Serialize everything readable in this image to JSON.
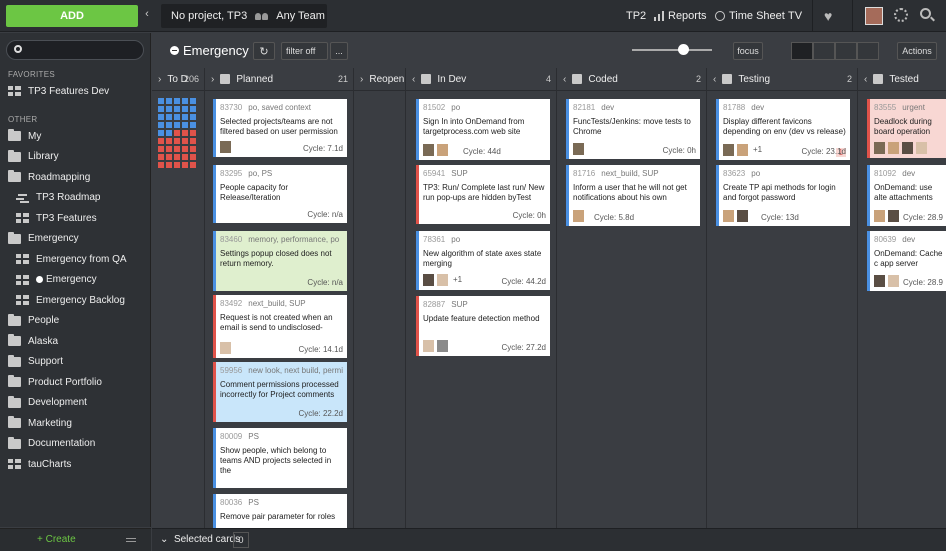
{
  "top": {
    "add": "ADD",
    "context_project": "No project, TP3",
    "context_team": "Any Team",
    "nav": [
      "TP2",
      "Reports",
      "Time Sheet",
      "TV"
    ]
  },
  "sidebar": {
    "favorites_header": "FAVORITES",
    "favorites": [
      {
        "label": "TP3 Features Dev",
        "icon": "board-icon"
      }
    ],
    "other_header": "OTHER",
    "items": [
      {
        "label": "My",
        "icon": "folder-icon",
        "indent": 0
      },
      {
        "label": "Library",
        "icon": "folder-icon",
        "indent": 0
      },
      {
        "label": "Roadmapping",
        "icon": "folder-icon",
        "indent": 0
      },
      {
        "label": "TP3 Roadmap",
        "icon": "roadmap-icon",
        "indent": 1
      },
      {
        "label": "TP3 Features",
        "icon": "board-icon",
        "indent": 1
      },
      {
        "label": "Emergency",
        "icon": "folder-icon",
        "indent": 0
      },
      {
        "label": "Emergency from QA",
        "icon": "board-icon",
        "indent": 1
      },
      {
        "label": "Emergency",
        "icon": "board-icon",
        "indent": 1,
        "active": true
      },
      {
        "label": "Emergency Backlog",
        "icon": "board-icon",
        "indent": 1
      },
      {
        "label": "People",
        "icon": "folder-icon",
        "indent": 0
      },
      {
        "label": "Alaska",
        "icon": "folder-icon",
        "indent": 0
      },
      {
        "label": "Support",
        "icon": "folder-icon",
        "indent": 0
      },
      {
        "label": "Product Portfolio",
        "icon": "folder-icon",
        "indent": 0
      },
      {
        "label": "Development",
        "icon": "folder-icon",
        "indent": 0
      },
      {
        "label": "Marketing",
        "icon": "folder-icon",
        "indent": 0
      },
      {
        "label": "Documentation",
        "icon": "folder-icon",
        "indent": 0
      },
      {
        "label": "tauCharts",
        "icon": "board-icon",
        "indent": 0
      }
    ],
    "create": "+ Create"
  },
  "board": {
    "title": "Emergency",
    "filter": "filter off",
    "more": "...",
    "focus": "focus",
    "actions": "Actions",
    "selected_cards": "Selected cards",
    "selected_count": "0"
  },
  "columns": [
    {
      "name": "To D",
      "count": "206"
    },
    {
      "name": "Planned",
      "count": "21"
    },
    {
      "name": "Reopen",
      "count": ""
    },
    {
      "name": "In Dev",
      "count": "4"
    },
    {
      "name": "Coded",
      "count": "2"
    },
    {
      "name": "Testing",
      "count": "2"
    },
    {
      "name": "Tested",
      "count": ""
    }
  ],
  "cards": {
    "planned": [
      {
        "id": "83730",
        "tags": "po, saved context",
        "title": "Selected projects/teams are not filtered based on user permission",
        "cycle": "Cycle: 7.1d"
      },
      {
        "id": "83295",
        "tags": "po, PS",
        "title": "People capacity for Release/Iteration",
        "cycle": "Cycle: n/a"
      },
      {
        "id": "83460",
        "tags": "memory, performance, po",
        "title": "Settings popup closed does not return memory.",
        "cycle": "Cycle: n/a"
      },
      {
        "id": "83492",
        "tags": "next_build, SUP",
        "title": "Request is not created when an email is send to undisclosed-",
        "cycle": "Cycle: 14.1d"
      },
      {
        "id": "59956",
        "tags": "new look, next build, permi",
        "title": "Comment permissions processed incorrectly for Project comments",
        "cycle": "Cycle: 22.2d"
      },
      {
        "id": "80009",
        "tags": "PS",
        "title": "Show people, which belong to teams AND projects selected in the",
        "cycle": ""
      },
      {
        "id": "80036",
        "tags": "PS",
        "title": "Remove pair parameter for roles",
        "cycle": ""
      }
    ],
    "indev": [
      {
        "id": "81502",
        "tags": "po",
        "title": "Sign In into OnDemand from targetprocess.com web site",
        "cycle": "Cycle: 44d"
      },
      {
        "id": "65941",
        "tags": "SUP",
        "title": "TP3: Run/ Complete last run/ New run pop-ups are hidden byTest",
        "cycle": "Cycle: 0h"
      },
      {
        "id": "78361",
        "tags": "po",
        "title": "New algorithm of state axes state merging",
        "cycle": "Cycle: 44.2d",
        "extra": "+1"
      },
      {
        "id": "82887",
        "tags": "SUP",
        "title": "Update feature detection method",
        "cycle": "Cycle: 27.2d"
      }
    ],
    "coded": [
      {
        "id": "82181",
        "tags": "dev",
        "title": "FuncTests/Jenkins: move tests to Chrome",
        "cycle": "Cycle: 0h"
      },
      {
        "id": "81716",
        "tags": "next_build, SUP",
        "title": "Inform a user that he will not get notifications about his own",
        "cycle": "Cycle: 5.8d"
      }
    ],
    "testing": [
      {
        "id": "81788",
        "tags": "dev",
        "title": "Display different favicons depending on env (dev vs release)",
        "cycle": "Cycle: 23.1d",
        "extra": "+1",
        "badge": "1"
      },
      {
        "id": "83623",
        "tags": "po",
        "title": "Create TP api methods for login and forgot password",
        "cycle": "Cycle: 13d"
      }
    ],
    "tested": [
      {
        "id": "83555",
        "tags": "urgent",
        "title": "Deadlock during board operation",
        "cycle": ""
      },
      {
        "id": "81092",
        "tags": "dev",
        "title": "OnDemand: use alte attachments",
        "cycle": "Cycle: 28.9"
      },
      {
        "id": "80639",
        "tags": "dev",
        "title": "OnDemand: Cache c app server",
        "cycle": "Cycle: 28.9"
      }
    ]
  },
  "colors": {
    "accent": "#6cc644",
    "bg": "#3a3d42",
    "sidebar": "#2e3135"
  }
}
